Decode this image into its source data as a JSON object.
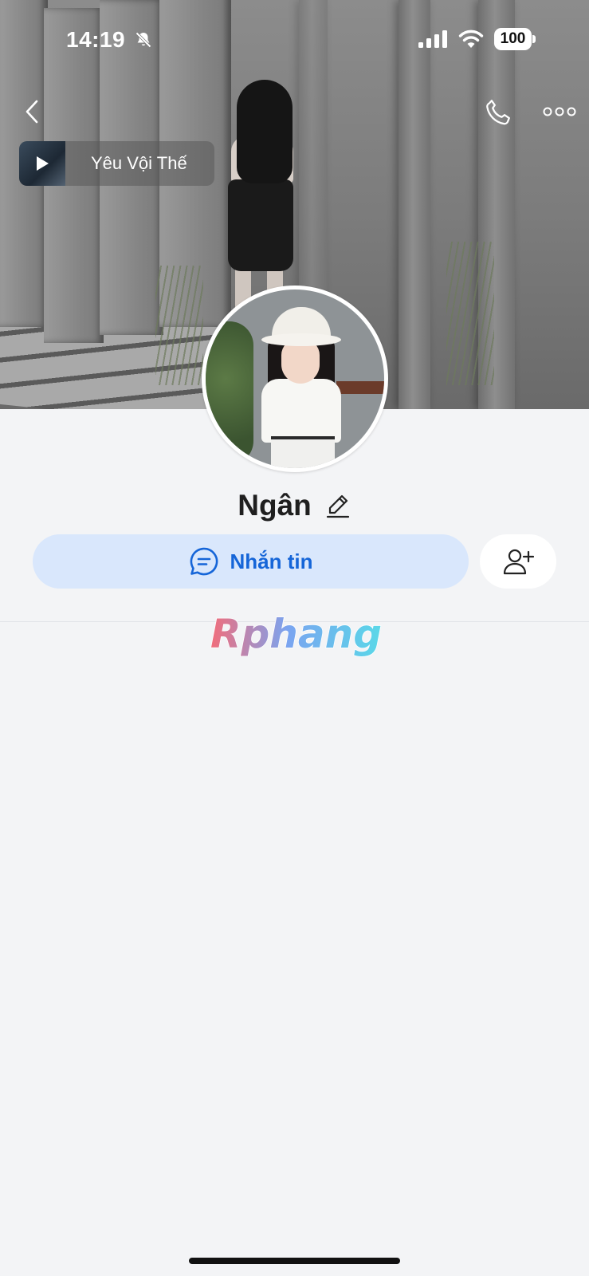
{
  "status_bar": {
    "time": "14:19",
    "battery": "100",
    "icons": [
      "bell-slash-icon",
      "cellular-signal-icon",
      "wifi-icon",
      "battery-icon"
    ]
  },
  "nav": {
    "icons": [
      "chevron-left-icon",
      "phone-icon",
      "more-horizontal-icon"
    ]
  },
  "music": {
    "title": "Yêu Vội Thế",
    "icon": "play-icon"
  },
  "profile": {
    "name": "Ngân",
    "edit_icon": "pencil-icon"
  },
  "actions": {
    "message_label": "Nhắn tin",
    "message_icon": "chat-bubble-icon",
    "add_friend_icon": "user-plus-icon",
    "accent_color": "#1565d8",
    "accent_bg": "#d9e7fc"
  },
  "watermark": {
    "text": "Rphang"
  }
}
